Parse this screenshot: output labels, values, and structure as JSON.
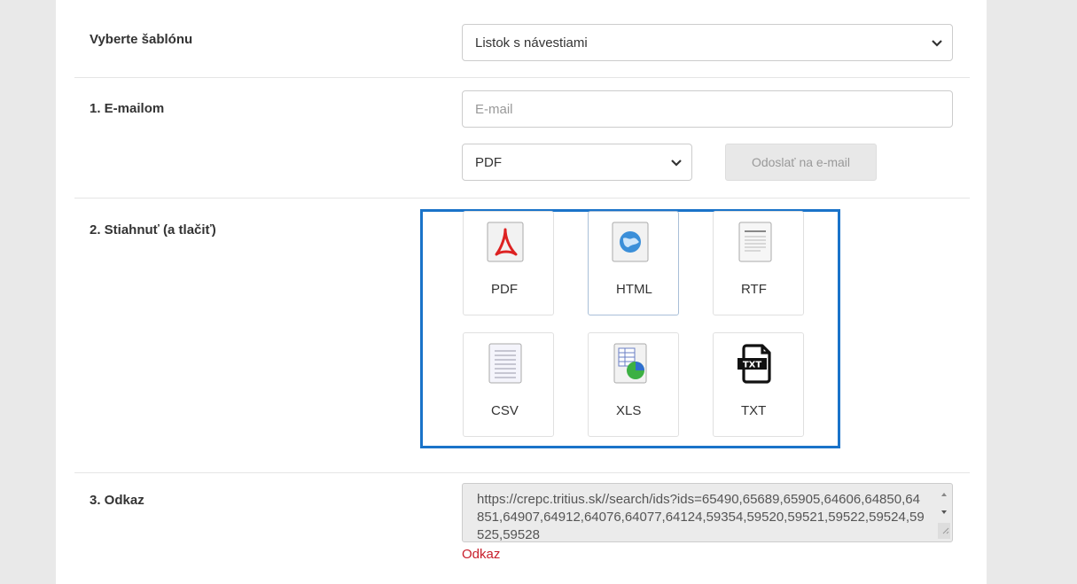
{
  "template": {
    "label": "Vyberte šablónu",
    "selected": "Listok s návestiami"
  },
  "email": {
    "label": "1. E-mailom",
    "placeholder": "E-mail",
    "format_selected": "PDF",
    "send_label": "Odoslať na e-mail"
  },
  "download": {
    "label": "2. Stiahnuť (a tlačiť)",
    "formats": [
      {
        "label": "PDF",
        "icon": "pdf-icon"
      },
      {
        "label": "HTML",
        "icon": "html-globe-icon"
      },
      {
        "label": "RTF",
        "icon": "rtf-document-icon"
      },
      {
        "label": "CSV",
        "icon": "csv-document-icon"
      },
      {
        "label": "XLS",
        "icon": "xls-spreadsheet-icon"
      },
      {
        "label": "TXT",
        "icon": "txt-file-icon"
      }
    ]
  },
  "link": {
    "label": "3. Odkaz",
    "url": "https://crepc.tritius.sk//search/ids?ids=65490,65689,65905,64606,64850,64851,64907,64912,64076,64077,64124,59354,59520,59521,59522,59524,59525,59528",
    "link_text": "Odkaz"
  },
  "colors": {
    "highlight": "#1a73c9",
    "link": "#c81e2b"
  }
}
